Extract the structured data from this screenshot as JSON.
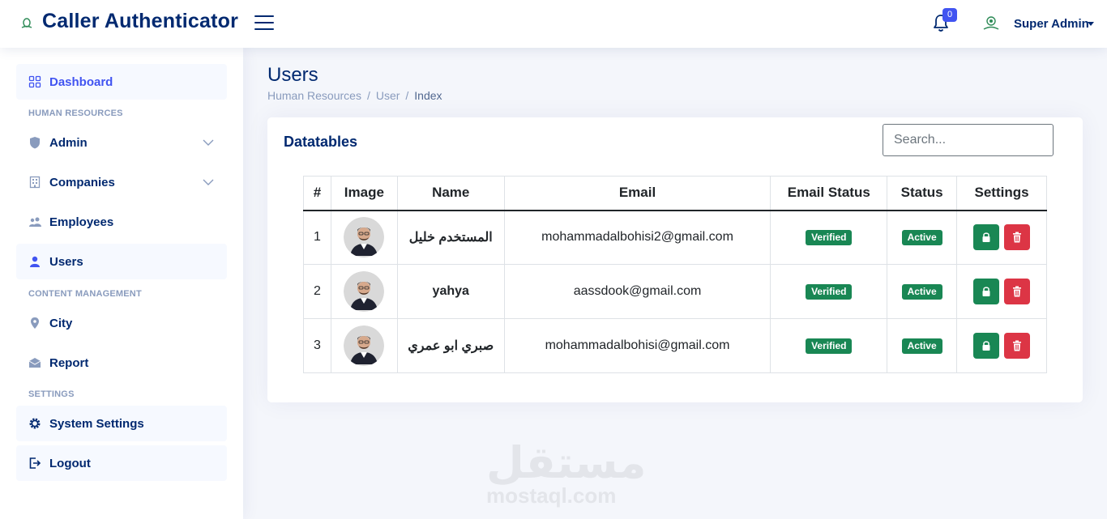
{
  "header": {
    "app_title": "Caller Authenticator",
    "notification_count": "0",
    "user_name": "Super Admin"
  },
  "sidebar": {
    "items": [
      {
        "label": "Dashboard",
        "icon": "grid-icon"
      },
      {
        "label": "Admin",
        "icon": "shield-icon"
      },
      {
        "label": "Companies",
        "icon": "building-icon"
      },
      {
        "label": "Employees",
        "icon": "people-icon"
      },
      {
        "label": "Users",
        "icon": "person-icon"
      },
      {
        "label": "City",
        "icon": "geo-pin-icon"
      },
      {
        "label": "Report",
        "icon": "envelope-icon"
      },
      {
        "label": "System Settings",
        "icon": "gear-icon"
      },
      {
        "label": "Logout",
        "icon": "logout-icon"
      }
    ],
    "headings": [
      "HUMAN RESOURCES",
      "CONTENT MANAGEMENT",
      "SETTINGS"
    ]
  },
  "page": {
    "title": "Users",
    "breadcrumb": [
      "Human Resources",
      "/",
      "User",
      "/",
      "Index"
    ]
  },
  "card": {
    "title": "Datatables",
    "search_placeholder": "Search..."
  },
  "table": {
    "headers": [
      "#",
      "Image",
      "Name",
      "Email",
      "Email Status",
      "Status",
      "Settings"
    ],
    "rows": [
      {
        "num": "1",
        "name": "المستخدم خليل",
        "email": "mohammadalbohisi2@gmail.com",
        "email_status": "Verified",
        "status": "Active"
      },
      {
        "num": "2",
        "name": "yahya",
        "email": "aassdook@gmail.com",
        "email_status": "Verified",
        "status": "Active"
      },
      {
        "num": "3",
        "name": "صبري ابو عمري",
        "email": "mohammadalbohisi@gmail.com",
        "email_status": "Verified",
        "status": "Active"
      }
    ]
  },
  "watermark": {
    "arabic": "مستقل",
    "latin": "mostaql.com"
  },
  "colors": {
    "primary": "#012970",
    "accent": "#4154f1",
    "success": "#198754",
    "danger": "#dc3545",
    "background": "#f4f6fb"
  }
}
